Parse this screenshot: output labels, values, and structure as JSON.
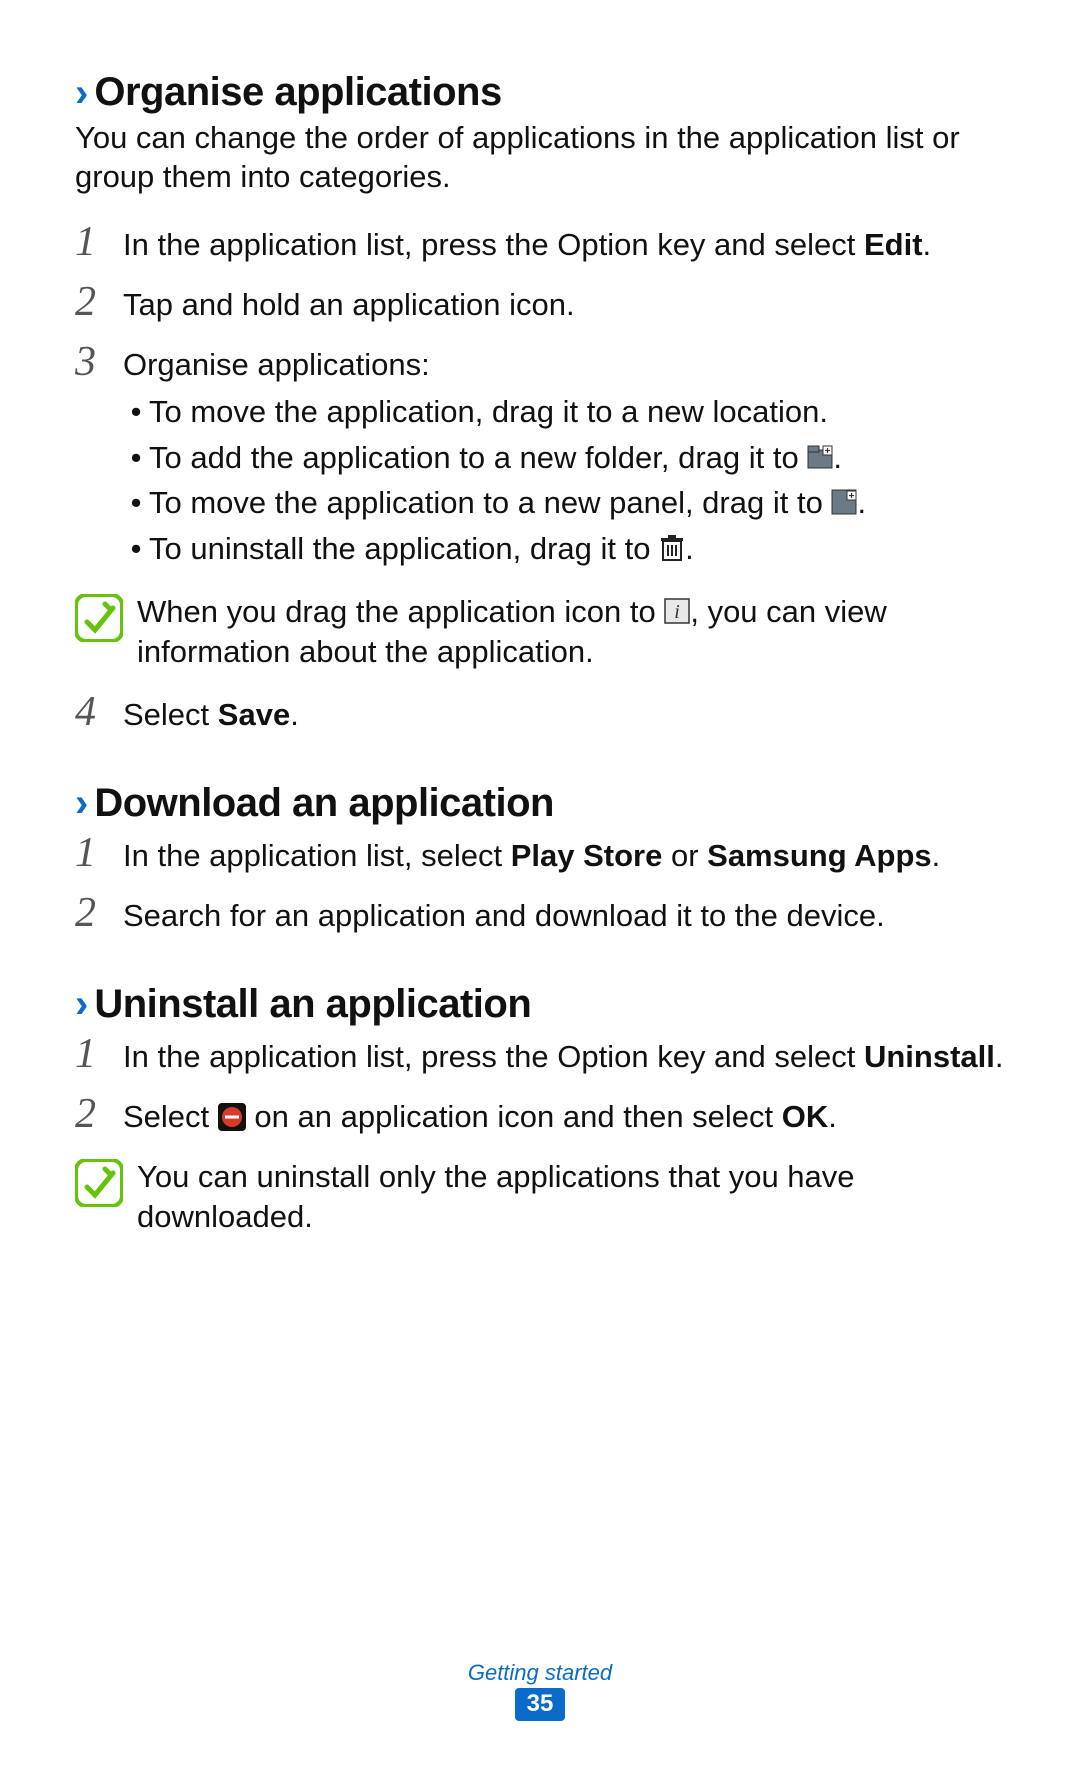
{
  "sections": {
    "organise": {
      "heading": "Organise applications",
      "intro": "You can change the order of applications in the application list or group them into categories.",
      "step1_a": "In the application list, press the Option key and select ",
      "step1_b": "Edit",
      "step1_c": ".",
      "step2": "Tap and hold an application icon.",
      "step3_lead": "Organise applications:",
      "step3_b1": "To move the application, drag it to a new location.",
      "step3_b2_a": "To add the application to a new folder, drag it to ",
      "step3_b2_b": ".",
      "step3_b3_a": "To move the application to a new panel, drag it to ",
      "step3_b3_b": ".",
      "step3_b4_a": "To uninstall the application, drag it to ",
      "step3_b4_b": ".",
      "note_a": "When you drag the application icon to ",
      "note_b": ", you can view information about the application.",
      "step4_a": "Select ",
      "step4_b": "Save",
      "step4_c": "."
    },
    "download": {
      "heading": "Download an application",
      "step1_a": "In the application list, select ",
      "step1_b": "Play Store",
      "step1_c": " or ",
      "step1_d": "Samsung Apps",
      "step1_e": ".",
      "step2": "Search for an application and download it to the device."
    },
    "uninstall": {
      "heading": "Uninstall an application",
      "step1_a": "In the application list, press the Option key and select ",
      "step1_b": "Uninstall",
      "step1_c": ".",
      "step2_a": "Select ",
      "step2_b": " on an application icon and then select ",
      "step2_c": "OK",
      "step2_d": ".",
      "note": "You can uninstall only the applications that you have downloaded."
    }
  },
  "footer": {
    "chapter": "Getting started",
    "page": "35"
  }
}
